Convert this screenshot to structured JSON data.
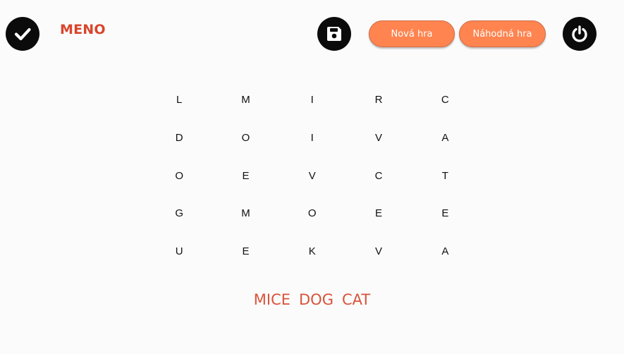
{
  "header": {
    "menu_label": "MENO",
    "new_game_label": "Nová hra",
    "random_game_label": "Náhodná hra"
  },
  "grid": {
    "rows": [
      [
        "L",
        "M",
        "I",
        "R",
        "C"
      ],
      [
        "D",
        "O",
        "I",
        "V",
        "A"
      ],
      [
        "O",
        "E",
        "V",
        "C",
        "T"
      ],
      [
        "G",
        "M",
        "O",
        "E",
        "E"
      ],
      [
        "U",
        "E",
        "K",
        "V",
        "A"
      ]
    ]
  },
  "words": [
    "MICE",
    "DOG",
    "CAT"
  ],
  "colors": {
    "accent": "#ff8450",
    "title_red": "#d9452c",
    "word_red": "#d9533a",
    "icon_bg": "#0b0b0b"
  }
}
